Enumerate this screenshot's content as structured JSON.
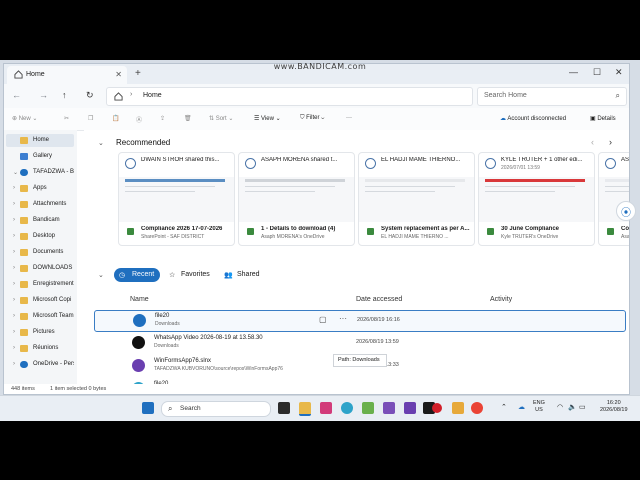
{
  "watermark": "www.BANDICAM.com",
  "window": {
    "tab_title": "Home",
    "new_tab": "+",
    "controls": [
      "—",
      "☐",
      "✕"
    ]
  },
  "address": {
    "path": "Home",
    "search_placeholder": "Search Home"
  },
  "toolbar": {
    "new_label": "New",
    "sort_label": "Sort",
    "view_label": "View",
    "filter_label": "Filter",
    "more_label": "···",
    "account_label": "Account disconnected",
    "details_label": "Details"
  },
  "sidebar": {
    "items": [
      {
        "label": "Home",
        "selected": true,
        "type": "home"
      },
      {
        "label": "Gallery",
        "type": "gallery"
      },
      {
        "label": "TAFADZWA - Bu",
        "type": "cloud",
        "expand": "⌄"
      },
      {
        "label": "Apps",
        "type": "folder",
        "expand": "›"
      },
      {
        "label": "Attachments",
        "type": "folder",
        "expand": "›"
      },
      {
        "label": "Bandicam",
        "type": "folder",
        "expand": "›"
      },
      {
        "label": "Desktop",
        "type": "folder",
        "expand": "›"
      },
      {
        "label": "Documents",
        "type": "folder",
        "expand": "›"
      },
      {
        "label": "DOWNLOADS",
        "type": "folder",
        "expand": "›"
      },
      {
        "label": "Enregistrement",
        "type": "folder",
        "expand": "›"
      },
      {
        "label": "Microsoft Copi",
        "type": "folder",
        "expand": "›"
      },
      {
        "label": "Microsoft Team",
        "type": "folder",
        "expand": "›"
      },
      {
        "label": "Pictures",
        "type": "folder",
        "expand": "›"
      },
      {
        "label": "Réunions",
        "type": "folder",
        "expand": "›"
      },
      {
        "label": "OneDrive - Perso",
        "type": "cloud",
        "expand": "›"
      }
    ]
  },
  "recommended": {
    "title": "Recommended",
    "cards": [
      {
        "who": "DWAIN STROH shared this...",
        "date": "",
        "name": "Compliance 2026 17-07-2026",
        "source": "SharePoint - SAF DISTRICT"
      },
      {
        "who": "ASAPH MORENA shared t...",
        "date": "",
        "name": "1 - Details to download (4)",
        "source": "Asaph MORENA's OneDrive"
      },
      {
        "who": "EL HADJI MAME THIERNO...",
        "date": "",
        "name": "System replacement as per A...",
        "source": "EL HADJI MAME THIERNO ..."
      },
      {
        "who": "KYLE TRUTER + 1 other edi...",
        "date": "2026/07/01 13:59",
        "name": "30 June Compliance",
        "source": "Kyle TRUTER's OneDrive"
      },
      {
        "who": "ASA",
        "date": "",
        "name": "Co",
        "source": "Asa"
      }
    ]
  },
  "filters": {
    "recent": "Recent",
    "favorites": "Favorites",
    "shared": "Shared"
  },
  "columns": {
    "name": "Name",
    "date": "Date accessed",
    "activity": "Activity"
  },
  "files": [
    {
      "name": "file20",
      "location": "Downloads",
      "date": "2026/08/19 16:16",
      "selected": true
    },
    {
      "name": "WhatsApp Video 2026-08-19 at 13.58.30",
      "location": "Downloads",
      "date": "2026/08/19 13:59"
    },
    {
      "name": "WinFormsApp76.slnx",
      "location": "TAFADZWA KUBVORUNO\\source\\repos\\WinFormsApp76",
      "date": "2026/08/19 13:33"
    },
    {
      "name": "file20",
      "location": "",
      "date": ""
    }
  ],
  "tooltip": "Path: Downloads",
  "status": {
    "items": "448 items",
    "selected": "1 item selected  0 bytes"
  },
  "taskbar": {
    "search": "Search",
    "lang_top": "ENG",
    "lang_bottom": "US",
    "time": "16:20",
    "date": "2026/08/19"
  },
  "colors": {
    "accent": "#1f6fbf",
    "folder": "#e8b84a",
    "selection": "#3a7dc4"
  }
}
